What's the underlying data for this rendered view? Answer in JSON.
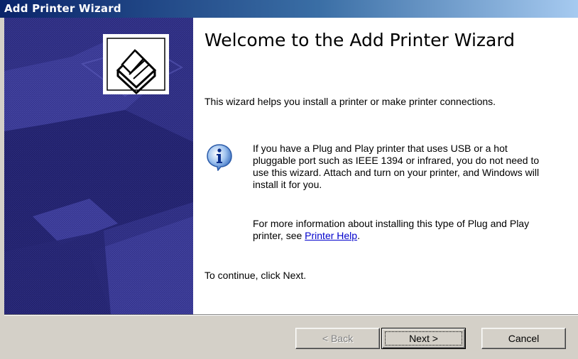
{
  "window": {
    "title": "Add Printer Wizard"
  },
  "wizard": {
    "heading": "Welcome to the Add Printer Wizard",
    "intro": "This wizard helps you install a printer or make printer connections.",
    "info_paragraph_1": "If you have a Plug and Play printer that uses USB or a hot pluggable port such as IEEE 1394 or infrared, you do not need to use this wizard. Attach and turn on your printer, and Windows will install it for you.",
    "info_paragraph_2_prefix": "For more information about installing this type of Plug and Play printer, see ",
    "info_link": "Printer Help",
    "info_paragraph_2_suffix": ".",
    "continue_text": "To continue, click Next.",
    "info_icon": "info-icon",
    "sidebar_icon": "printer-icon"
  },
  "buttons": {
    "back_label": "< Back",
    "next_label": "Next >",
    "cancel_label": "Cancel",
    "back_enabled": false
  },
  "colors": {
    "titlebar_start": "#0a246a",
    "titlebar_end": "#a6caf0",
    "sidebar_blue": "#2b2b7f",
    "link": "#0000cc"
  }
}
